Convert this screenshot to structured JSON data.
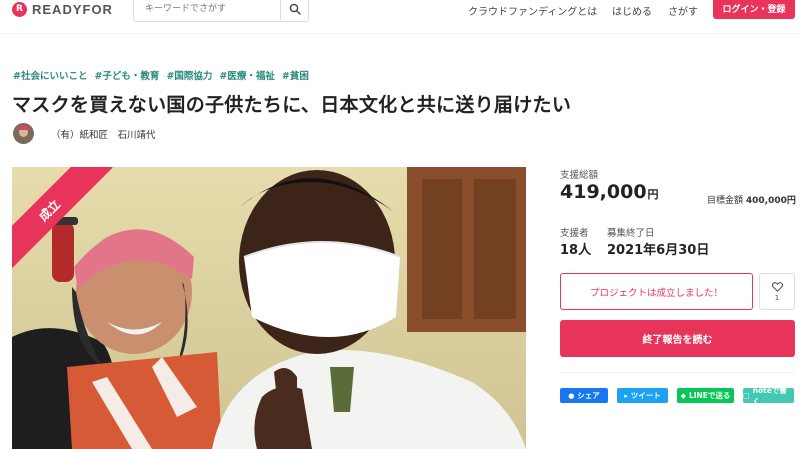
{
  "header": {
    "brand": "READYFOR",
    "logo_mark": "R",
    "search_placeholder": "キーワードでさがす",
    "nav": {
      "about": "クラウドファンディングとは",
      "start": "はじめる",
      "find": "さがす"
    },
    "login_label": "ログイン・登録",
    "accent_color": "#e8345a"
  },
  "project": {
    "tags": [
      "#社会にいいこと",
      "#子ども・教育",
      "#国際協力",
      "#医療・福祉",
      "#貧困"
    ],
    "title": "マスクを買えない国の子供たちに、日本文化と共に送り届けたい",
    "author": "（有）紙和匠　石川靖代",
    "ribbon": "成立"
  },
  "stats": {
    "total_label": "支援総額",
    "total_value": "419,000",
    "total_unit": "円",
    "goal_label": "目標金額",
    "goal_value": "400,000円",
    "supporters_label": "支援者",
    "supporters_value": "18人",
    "end_label": "募集終了日",
    "end_value": "2021年6月30日"
  },
  "actions": {
    "success_label": "プロジェクトは成立しました！",
    "favorite_count": "1",
    "report_label": "終了報告を読む"
  },
  "share": {
    "facebook": "シェア",
    "twitter": "ツイート",
    "line": "LINEで送る",
    "note": "noteで書く"
  }
}
